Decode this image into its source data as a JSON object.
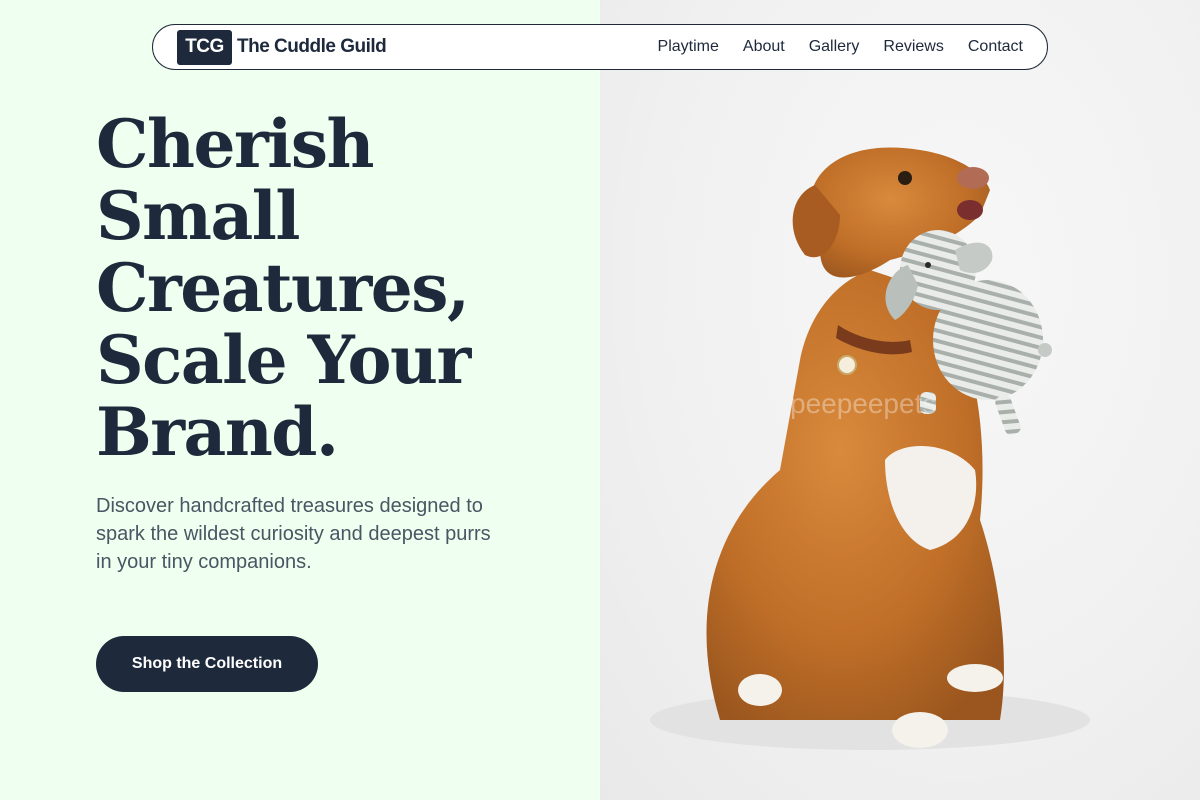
{
  "brand": {
    "badge": "TCG",
    "name": "The Cuddle Guild"
  },
  "nav": {
    "items": [
      "Playtime",
      "About",
      "Gallery",
      "Reviews",
      "Contact"
    ]
  },
  "hero": {
    "title_lines": [
      "Cherish",
      "Small",
      "Creatures,",
      "Scale Your",
      "Brand."
    ],
    "subtitle": "Discover handcrafted treasures designed to spark the wildest curiosity and deepest purrs in your tiny companions.",
    "cta_label": "Shop the Collection"
  },
  "image": {
    "subject": "dog-holding-plush-elephant-photo",
    "watermark": "peepeepets"
  },
  "colors": {
    "left_background": "#effff0",
    "primary_dark": "#1e293b",
    "text_muted": "#4b5563",
    "photo_background": "#f1f1f1"
  }
}
